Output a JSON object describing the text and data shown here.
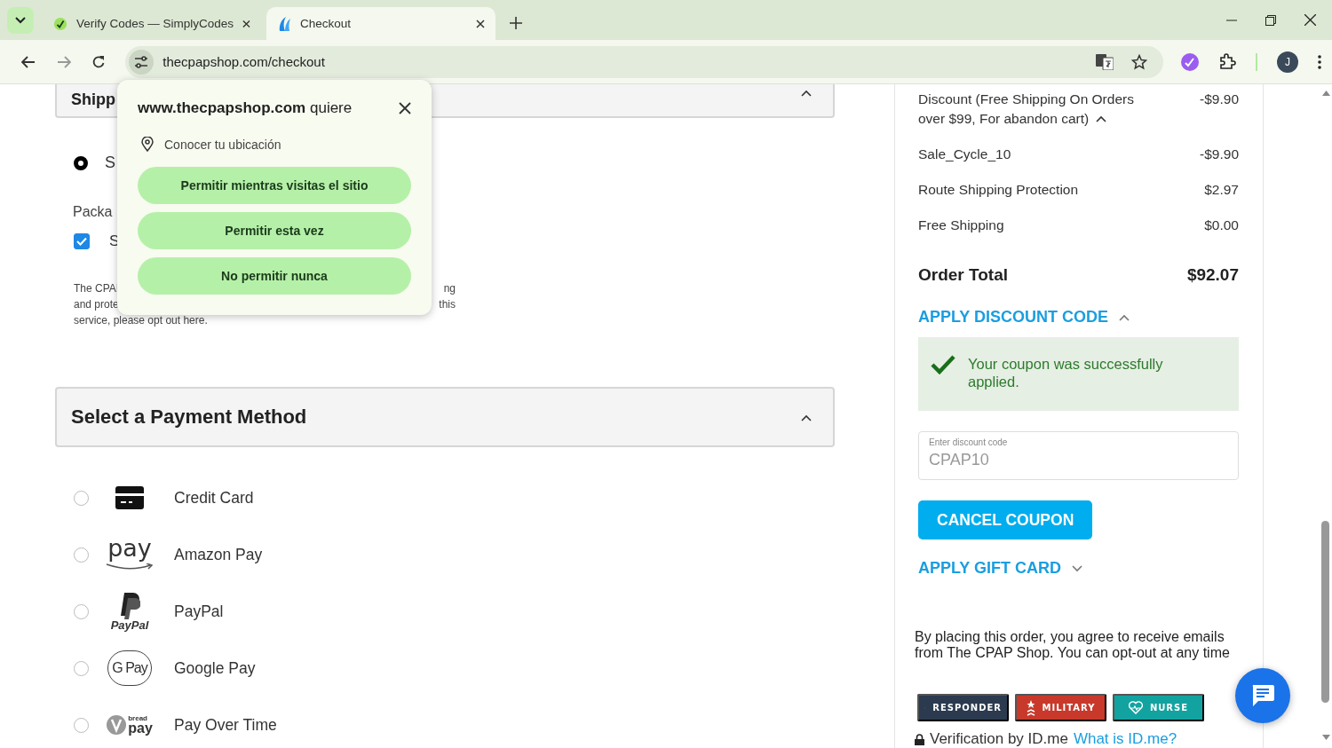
{
  "browser": {
    "tabs": [
      {
        "title": "Verify Codes — SimplyCodes",
        "selected": false
      },
      {
        "title": "Checkout",
        "selected": true
      }
    ],
    "url": "thecpapshop.com/checkout",
    "avatar": "J"
  },
  "permission_popup": {
    "site": "www.thecpapshop.com",
    "verb": "quiere",
    "request": "Conocer tu ubicación",
    "buttons": [
      "Permitir mientras visitas el sitio",
      "Permitir esta vez",
      "No permitir nunca"
    ]
  },
  "shipping": {
    "title": "Shipp",
    "expanded": true,
    "option_label": "S",
    "option_selected": true,
    "package_heading": "Packa",
    "protection_label": "S",
    "protection_checked": true,
    "notice_lines": [
      {
        "left": "The CPAI",
        "right": "ng"
      },
      {
        "left": "and prote",
        "right": "this"
      }
    ],
    "notice_end": "service, please opt out here."
  },
  "payment": {
    "title": "Select a Payment Method",
    "expanded": true,
    "methods": [
      {
        "kind": "card",
        "label": "Credit Card",
        "selected": false
      },
      {
        "kind": "amazon",
        "logo": "pay",
        "label": "Amazon Pay",
        "selected": false
      },
      {
        "kind": "paypal",
        "logo": "PayPal",
        "label": "PayPal",
        "selected": false
      },
      {
        "kind": "gpay",
        "logo": "G Pay",
        "label": "Google Pay",
        "selected": false
      },
      {
        "kind": "bread",
        "logo": "bread",
        "logo_sub": "pay",
        "label": "Pay Over Time",
        "selected": false
      }
    ]
  },
  "summary": {
    "lines": [
      {
        "label": "Discount (Free Shipping On Orders over $99, For abandon cart)",
        "amount": "-$9.90",
        "expanded": true
      },
      {
        "label": "Sale_Cycle_10",
        "amount": "-$9.90"
      },
      {
        "label": "Route Shipping Protection",
        "amount": "$2.97"
      },
      {
        "label": "Free Shipping",
        "amount": "$0.00"
      }
    ],
    "total_label": "Order Total",
    "total": "$92.07",
    "discount_toggle": {
      "label": "APPLY DISCOUNT CODE",
      "expanded": true
    },
    "success": "Your coupon was successfully applied.",
    "code_field": {
      "label": "Enter discount code",
      "value": "CPAP10"
    },
    "cancel_button": "CANCEL COUPON",
    "gift_toggle": {
      "label": "APPLY GIFT CARD",
      "expanded": false
    },
    "consent": "By placing this order, you agree to receive emails from The CPAP Shop. You can opt-out at any time",
    "badges": [
      {
        "kind": "responder",
        "label": "RESPONDER",
        "color": "#2b3a4e"
      },
      {
        "kind": "military",
        "label": "MILITARY",
        "color": "#c8392b"
      },
      {
        "kind": "nurse",
        "label": "NURSE",
        "color": "#12a3a0"
      }
    ],
    "verification": "Verification by ID.me",
    "verification_link": "What is ID.me?"
  }
}
